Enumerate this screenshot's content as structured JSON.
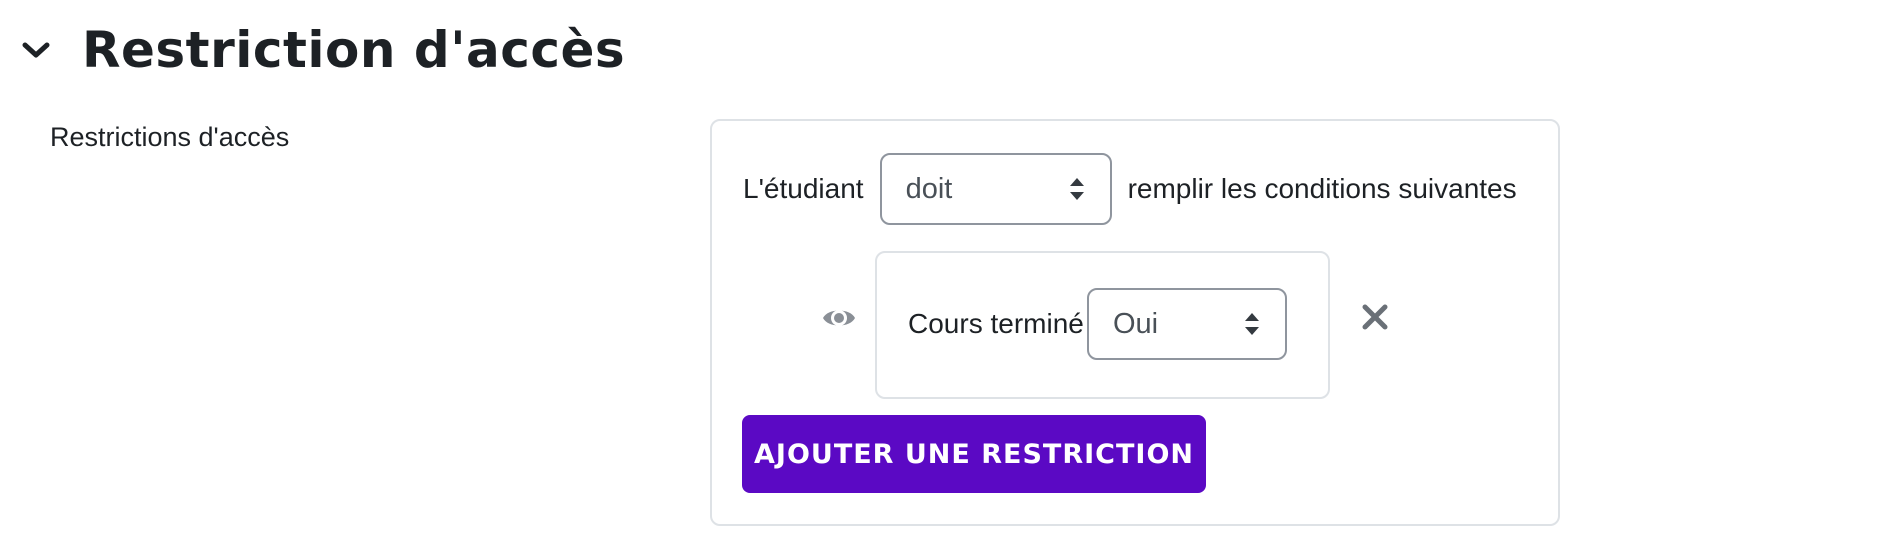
{
  "section": {
    "title": "Restriction d'accès",
    "chevron_icon": "chevron-down-icon"
  },
  "field": {
    "label": "Restrictions d'accès"
  },
  "restriction": {
    "prefix": "L'étudiant",
    "requirement_select": {
      "value": "doit",
      "icon": "sort-caret-icon"
    },
    "suffix": "remplir les conditions suivantes",
    "condition": {
      "visibility_icon": "eye-icon",
      "label": "Cours terminé",
      "select": {
        "value": "Oui",
        "icon": "sort-caret-icon"
      },
      "delete_icon": "close-icon"
    },
    "add_button": {
      "label": "AJOUTER UNE RESTRICTION",
      "color": "#5b09c4"
    }
  }
}
